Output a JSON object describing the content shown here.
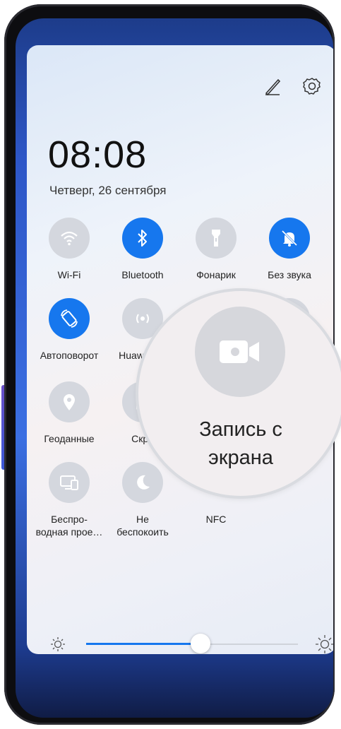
{
  "clock": {
    "time": "08:08",
    "date": "Четверг, 26 сентября"
  },
  "top_icons": [
    "edit-pencil-icon",
    "settings-gear-icon"
  ],
  "tiles": [
    {
      "label": "Wi-Fi",
      "icon": "wifi-icon",
      "active": false
    },
    {
      "label": "Bluetooth",
      "icon": "bluetooth-icon",
      "active": true
    },
    {
      "label": "Фонарик",
      "icon": "flashlight-icon",
      "active": false
    },
    {
      "label": "Без звука",
      "icon": "mute-bell-icon",
      "active": true
    },
    {
      "label": "Автоповорот",
      "icon": "auto-rotate-icon",
      "active": true
    },
    {
      "label": "Huawei Sh",
      "icon": "huawei-share-icon",
      "active": false
    },
    {
      "label": "Геоданные",
      "icon": "location-pin-icon",
      "active": false
    },
    {
      "label": "Скри",
      "icon": "screenshot-icon",
      "active": false
    },
    {
      "label": "Беспро-\nводная прое…",
      "label_line1": "Беспро-",
      "label_line2": "водная прое…",
      "icon": "wireless-projection-icon",
      "active": false
    },
    {
      "label_line1": "Не",
      "label_line2": "беспокоить",
      "icon": "do-not-disturb-moon-icon",
      "active": false
    },
    {
      "label": "NFC",
      "icon": "nfc-icon",
      "active": false
    }
  ],
  "magnifier": {
    "label_line1": "Запись с",
    "label_line2": "экрана",
    "icon": "screen-record-camera-icon"
  },
  "brightness": {
    "level": 0.54,
    "accent": "#1677ee"
  },
  "colors": {
    "accent": "#1677ee",
    "inactive_tile": "#d4d7de"
  }
}
